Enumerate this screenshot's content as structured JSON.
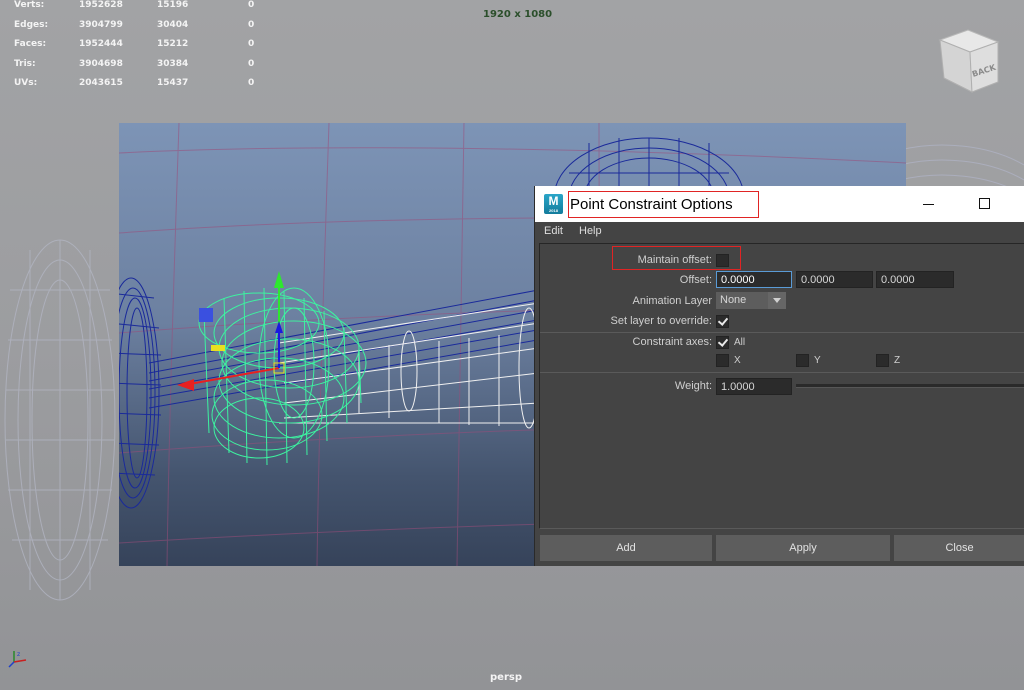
{
  "stats": {
    "rows": [
      {
        "label": "Verts:",
        "values": [
          "1952628",
          "15196",
          "0"
        ]
      },
      {
        "label": "Edges:",
        "values": [
          "3904799",
          "30404",
          "0"
        ]
      },
      {
        "label": "Faces:",
        "values": [
          "1952444",
          "15212",
          "0"
        ]
      },
      {
        "label": "Tris:",
        "values": [
          "3904698",
          "30384",
          "0"
        ]
      },
      {
        "label": "UVs:",
        "values": [
          "2043615",
          "15437",
          "0"
        ]
      }
    ]
  },
  "viewport": {
    "resolution": "1920 x 1080",
    "camera": "persp",
    "view_cube_face": "BACK"
  },
  "dialog": {
    "app_icon_letter": "M",
    "app_icon_sub": "2018",
    "title": "Point Constraint Options",
    "menu": {
      "edit": "Edit",
      "help": "Help"
    },
    "maintain_offset_label": "Maintain offset:",
    "maintain_offset_checked": false,
    "offset_label": "Offset:",
    "offset_values": [
      "0.0000",
      "0.0000",
      "0.0000"
    ],
    "animation_layer_label": "Animation Layer",
    "animation_layer_value": "None",
    "set_layer_label": "Set layer to override:",
    "set_layer_checked": true,
    "constraint_axes_label": "Constraint axes:",
    "axes": {
      "all": "All",
      "x": "X",
      "y": "Y",
      "z": "Z"
    },
    "weight_label": "Weight:",
    "weight_value": "1.0000",
    "buttons": {
      "add": "Add",
      "apply": "Apply",
      "close": "Close"
    }
  },
  "colors": {
    "highlight": "#e02424",
    "wire_selected": "#3df2a0",
    "wire_mesh": "#1a2a9a"
  }
}
